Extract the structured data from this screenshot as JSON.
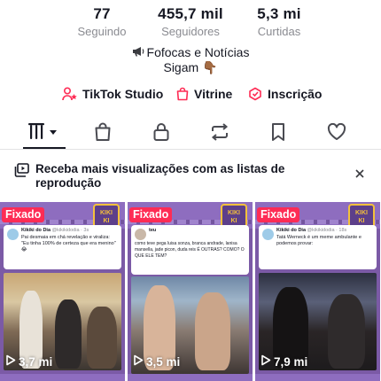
{
  "stats": [
    {
      "value": "77",
      "label": "Seguindo"
    },
    {
      "value": "455,7 mil",
      "label": "Seguidores"
    },
    {
      "value": "5,3 mi",
      "label": "Curtidas"
    }
  ],
  "bio": {
    "line1": "Fofocas e Notícias",
    "line2": "Sigam",
    "line1_icon": "megaphone-icon",
    "line2_emoji": "👇🏾"
  },
  "links": [
    {
      "label": "TikTok Studio",
      "icon": "person-star-icon"
    },
    {
      "label": "Vitrine",
      "icon": "shopping-bag-icon"
    },
    {
      "label": "Inscrição",
      "icon": "subscription-badge-icon"
    }
  ],
  "tabs": [
    {
      "name": "videos-grid",
      "icon": "grid-bars-icon",
      "active": true
    },
    {
      "name": "shop",
      "icon": "bag-icon"
    },
    {
      "name": "private",
      "icon": "lock-icon"
    },
    {
      "name": "reposts",
      "icon": "repost-icon"
    },
    {
      "name": "favorites",
      "icon": "bookmark-icon"
    },
    {
      "name": "liked",
      "icon": "heart-icon"
    }
  ],
  "banner": {
    "text": "Receba mais visualizações com as listas de reprodução",
    "icon": "playlist-icon"
  },
  "videos": [
    {
      "pinned_label": "Fixado",
      "views": "3,7 mi",
      "post_author": "Kikiki do Dia",
      "post_handle": "@kikikidodia · 3s",
      "post_text": "Pai desmaia em chá revelação e viraliza: \"Eu tinha 100% de certeza que era menino\" 😂"
    },
    {
      "pinned_label": "Fixado",
      "views": "3,5 mi",
      "post_author": "teu",
      "post_handle": "",
      "post_text": "como teve pega luisa sonza, branca andrade, lanisa mansella, jade picon, duda reis É OUTRAS? COMO? O QUE ELE TEM?"
    },
    {
      "pinned_label": "Fixado",
      "views": "7,9 mi",
      "post_author": "Kikiki do Dia",
      "post_handle": "@kikikidodia · 18s",
      "post_text": "Tatá Werneck é um meme ambulante e podemos provar:"
    }
  ],
  "colors": {
    "accent": "#fe2c55",
    "text": "#161823",
    "muted": "#8a8b91",
    "thumb_purple": "#7b5aa6"
  }
}
